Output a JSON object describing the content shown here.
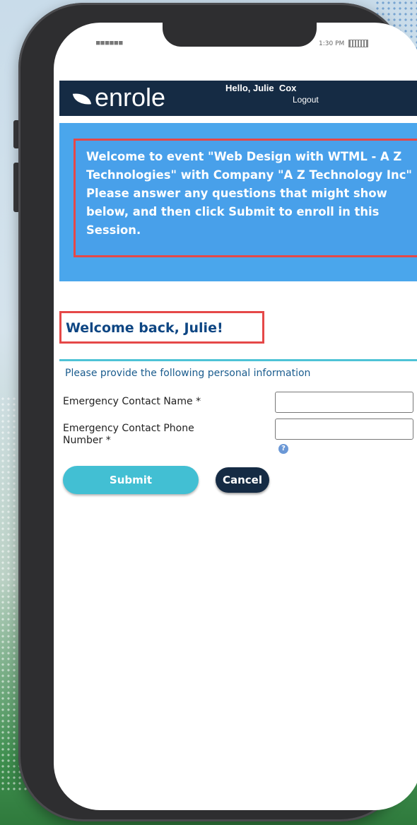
{
  "status_bar": {
    "carrier": "■■■■■■",
    "time": "1:30 PM"
  },
  "header": {
    "logo_text": "enrole",
    "greeting": "Hello, Julie  Cox",
    "logout_label": "Logout"
  },
  "event": {
    "lines": [
      "Welcome to event \"Web Design with WTML - A Z",
      "Technologies\" with Company \"A Z Technology Inc\"",
      "Please answer any questions that might show",
      "below, and then click Submit to enroll in this",
      "Session."
    ]
  },
  "welcome_title": "Welcome back, Julie!",
  "form": {
    "intro": "Please provide the following personal information",
    "fields": [
      {
        "label": "Emergency Contact Name *",
        "value": ""
      },
      {
        "label_line1": "Emergency Contact Phone",
        "label_line2": "Number *",
        "value": ""
      }
    ],
    "help_icon": "?",
    "submit_label": "Submit",
    "cancel_label": "Cancel"
  },
  "colors": {
    "header_bg": "#152b44",
    "event_bg": "#4aa6ec",
    "highlight_border": "#e54848",
    "accent": "#42bfd3",
    "title_text": "#0e4683"
  }
}
